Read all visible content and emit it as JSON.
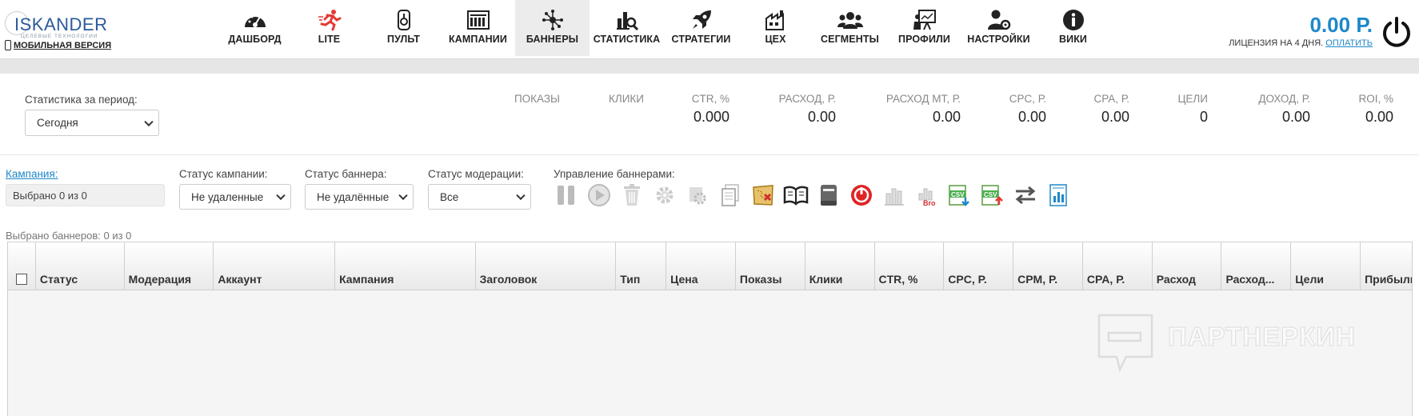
{
  "brand": {
    "name": "ISKANDER",
    "tagline": "ЦЕЛЕВЫЕ ТЕХНОЛОГИИ",
    "mobile_link": "МОБИЛЬНАЯ ВЕРСИЯ"
  },
  "nav": {
    "items": [
      {
        "label": "ДАШБОРД",
        "icon": "dashboard-gauge-icon"
      },
      {
        "label": "LITE",
        "icon": "runner-icon"
      },
      {
        "label": "ПУЛЬТ",
        "icon": "remote-icon"
      },
      {
        "label": "КАМПАНИИ",
        "icon": "campaigns-icon"
      },
      {
        "label": "БАННЕРЫ",
        "icon": "banners-network-icon",
        "active": true
      },
      {
        "label": "СТАТИСТИКА",
        "icon": "statistics-icon"
      },
      {
        "label": "СТРАТЕГИИ",
        "icon": "rocket-icon"
      },
      {
        "label": "ЦЕХ",
        "icon": "factory-icon"
      },
      {
        "label": "СЕГМЕНТЫ",
        "icon": "users-group-icon"
      },
      {
        "label": "ПРОФИЛИ",
        "icon": "profile-board-icon"
      },
      {
        "label": "НАСТРОЙКИ",
        "icon": "user-settings-icon"
      },
      {
        "label": "ВИКИ",
        "icon": "info-icon"
      }
    ]
  },
  "account": {
    "balance": "0.00 Р.",
    "license_text": "ЛИЦЕНЗИЯ НА 4 ДНЯ.",
    "pay_link": "ОПЛАТИТЬ"
  },
  "period": {
    "label": "Статистика за период:",
    "selected": "Сегодня"
  },
  "stats": [
    {
      "label": "ПОКАЗЫ",
      "value": ""
    },
    {
      "label": "КЛИКИ",
      "value": ""
    },
    {
      "label": "CTR, %",
      "value": "0.000"
    },
    {
      "label": "РАСХОД, Р.",
      "value": "0.00"
    },
    {
      "label": "РАСХОД МТ, Р.",
      "value": "0.00"
    },
    {
      "label": "CPC, Р.",
      "value": "0.00"
    },
    {
      "label": "CPA, Р.",
      "value": "0.00"
    },
    {
      "label": "ЦЕЛИ",
      "value": "0"
    },
    {
      "label": "ДОХОД, Р.",
      "value": "0.00"
    },
    {
      "label": "ROI, %",
      "value": "0.00"
    }
  ],
  "filters": {
    "campaign_label": "Кампания:",
    "campaign_value": "Выбрано 0 из 0",
    "campaign_status_label": "Статус кампании:",
    "campaign_status_value": "Не удаленные",
    "banner_status_label": "Статус баннера:",
    "banner_status_value": "Не удалённые",
    "moderation_status_label": "Статус модерации:",
    "moderation_status_value": "Все",
    "banner_mgmt_label": "Управление баннерами:"
  },
  "toolbar": [
    "pause-icon",
    "play-icon",
    "trash-icon",
    "gear-icon",
    "copy-settings-icon",
    "copy-icon",
    "map-icon",
    "open-book-icon",
    "book-icon",
    "stop-icon",
    "bar-chart-icon",
    "bro-chart-icon",
    "csv-export-icon",
    "csv-import-icon",
    "swap-arrows-icon",
    "report-icon"
  ],
  "selected_banners": "Выбрано баннеров: 0 из 0",
  "table": {
    "columns": [
      "Статус",
      "Модерация",
      "Аккаунт",
      "Кампания",
      "Заголовок",
      "Тип",
      "Цена",
      "Показы",
      "Клики",
      "CTR, %",
      "CPC, Р.",
      "CPM, Р.",
      "CPA, Р.",
      "Расход",
      "Расход...",
      "Цели",
      "Прибыль"
    ]
  },
  "watermark": "ПАРТНЕРКИН",
  "colors": {
    "accent": "#1e88c9",
    "nav_active_bg": "#ececec",
    "stop_red": "#e02424"
  }
}
